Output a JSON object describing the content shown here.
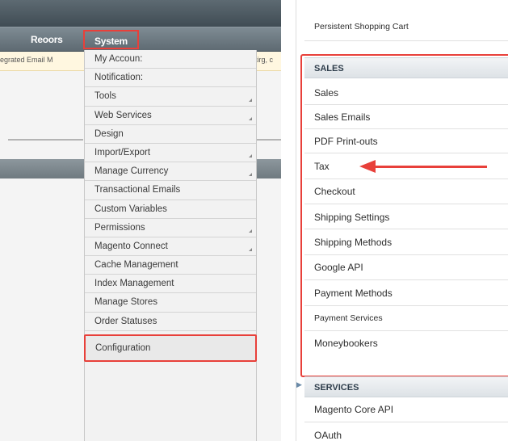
{
  "left_panel": {
    "nav": {
      "reports_label": "Reoors",
      "system_label": "System"
    },
    "notice": {
      "left_text": "iegrated Email M",
      "right_text": "tirg, c"
    },
    "system_menu": [
      {
        "label": "My Accoun:",
        "has_submenu": false
      },
      {
        "label": "Notification:",
        "has_submenu": false
      },
      {
        "label": "Tools",
        "has_submenu": true
      },
      {
        "label": "Web Services",
        "has_submenu": true
      },
      {
        "label": "Design",
        "has_submenu": false
      },
      {
        "label": "Import/Export",
        "has_submenu": true
      },
      {
        "label": "Manage Currency",
        "has_submenu": true
      },
      {
        "label": "Transactional Emails",
        "has_submenu": false
      },
      {
        "label": "Custom Variables",
        "has_submenu": false
      },
      {
        "label": "Permissions",
        "has_submenu": true
      },
      {
        "label": "Magento Connect",
        "has_submenu": true
      },
      {
        "label": "Cache Management",
        "has_submenu": false
      },
      {
        "label": "Index Management",
        "has_submenu": false
      },
      {
        "label": "Manage Stores",
        "has_submenu": false
      },
      {
        "label": "Order Statuses",
        "has_submenu": false
      }
    ],
    "configuration_label": "Configuration"
  },
  "right_panel": {
    "top_item": "Persistent Shopping Cart",
    "sales_header": "SALES",
    "sales_items": [
      "Sales",
      "Sales Emails",
      "PDF Print-outs",
      "Tax",
      "Checkout",
      "Shipping Settings",
      "Shipping Methods",
      "Google API",
      "Payment Methods",
      "Payment Services",
      "Moneybookers"
    ],
    "services_header": "SERVICES",
    "services_items": [
      "Magento Core API",
      "OAuth"
    ]
  },
  "colors": {
    "highlight": "#e8403a",
    "nav_bar": "#6e7a82"
  }
}
